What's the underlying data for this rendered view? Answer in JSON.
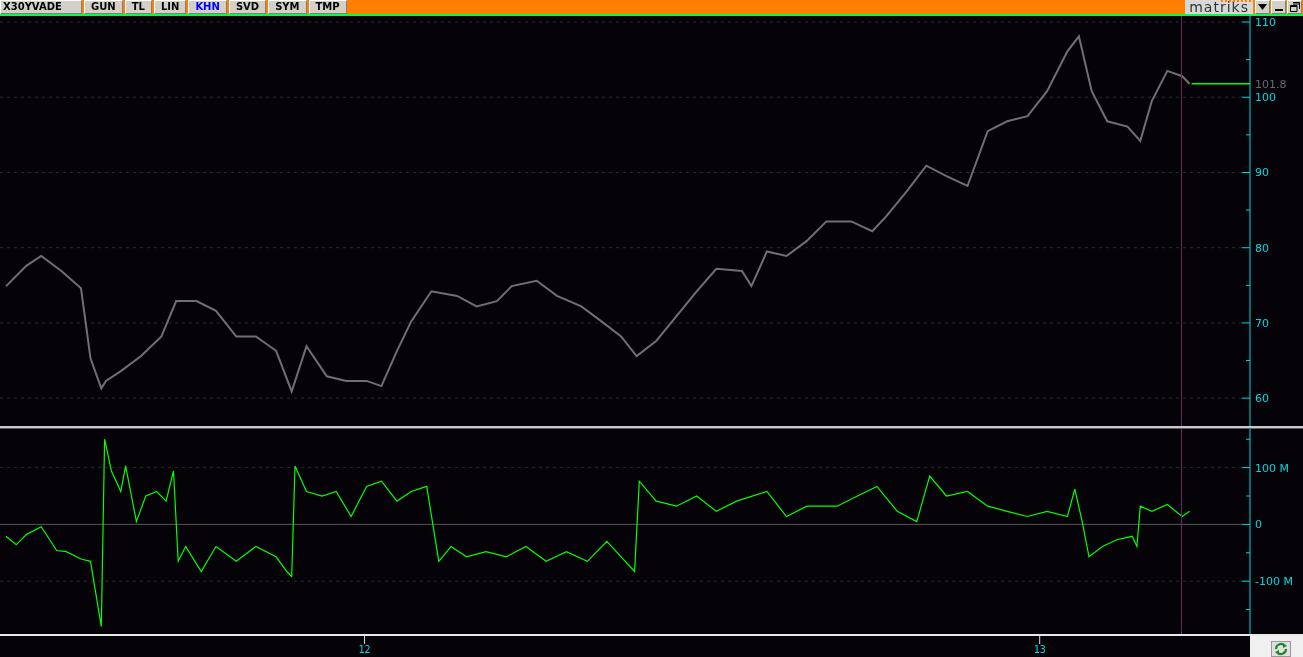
{
  "toolbar": {
    "symbol": "X30YVADE",
    "buttons": [
      {
        "label": "GUN",
        "selected": false
      },
      {
        "label": "TL",
        "selected": false
      },
      {
        "label": "LIN",
        "selected": false
      },
      {
        "label": "KHN",
        "selected": true
      },
      {
        "label": "SVD",
        "selected": false
      },
      {
        "label": "SYM",
        "selected": false
      },
      {
        "label": "TMP",
        "selected": false
      }
    ],
    "logo": "matriks"
  },
  "price_panel": {
    "chart_data": {
      "type": "line",
      "grid": true,
      "ref_lines": [
        {
          "axis": "x",
          "value": 13.21
        }
      ],
      "xlim": [
        11.46,
        13.39
      ],
      "ylim": [
        56.3,
        110.8
      ],
      "yticks": [
        60,
        70,
        80,
        90,
        100,
        110
      ],
      "x": [
        11.469,
        11.499,
        11.521,
        11.551,
        11.58,
        11.594,
        11.61,
        11.617,
        11.639,
        11.669,
        11.699,
        11.721,
        11.751,
        11.78,
        11.81,
        11.839,
        11.869,
        11.892,
        11.914,
        11.944,
        11.973,
        12.003,
        12.025,
        12.048,
        12.069,
        12.099,
        12.137,
        12.166,
        12.196,
        12.218,
        12.255,
        12.285,
        12.321,
        12.351,
        12.38,
        12.403,
        12.432,
        12.462,
        12.492,
        12.521,
        12.559,
        12.573,
        12.596,
        12.625,
        12.655,
        12.684,
        12.721,
        12.752,
        12.773,
        12.803,
        12.832,
        12.862,
        12.893,
        12.923,
        12.952,
        12.982,
        13.011,
        13.041,
        13.058,
        13.077,
        13.1,
        13.13,
        13.149,
        13.166,
        13.189,
        13.211,
        13.222
      ],
      "series": [
        {
          "color": "#707070",
          "values": [
            74.9,
            77.6,
            78.9,
            76.9,
            74.6,
            65.3,
            61.3,
            62.3,
            63.6,
            65.6,
            68.2,
            72.9,
            72.9,
            71.6,
            68.2,
            68.2,
            66.3,
            60.9,
            66.9,
            62.9,
            62.3,
            62.3,
            61.6,
            66.3,
            70.2,
            74.2,
            73.6,
            72.2,
            72.9,
            74.9,
            75.6,
            73.6,
            72.2,
            70.2,
            68.2,
            65.6,
            67.6,
            70.9,
            74.2,
            77.2,
            76.9,
            74.9,
            79.5,
            78.9,
            80.9,
            83.5,
            83.5,
            82.2,
            84.2,
            87.5,
            90.9,
            89.5,
            88.2,
            95.5,
            96.8,
            97.5,
            100.8,
            106.1,
            108.1,
            100.8,
            96.8,
            96.1,
            94.2,
            99.5,
            103.5,
            102.8,
            101.8
          ]
        }
      ],
      "annotations": [
        "101.8"
      ]
    }
  },
  "indicator_panel": {
    "chart_data": {
      "type": "line",
      "grid": true,
      "ref_lines": [
        {
          "axis": "x",
          "value": 13.21
        }
      ],
      "xlim": [
        11.46,
        13.39
      ],
      "ylim": [
        -193,
        168
      ],
      "yticks": [
        {
          "value": 100,
          "label": "100 M"
        },
        {
          "value": 0,
          "label": "0"
        },
        {
          "value": -100,
          "label": "-100 M"
        }
      ],
      "xticks": [
        12,
        13
      ],
      "x": [
        11.469,
        11.484,
        11.499,
        11.521,
        11.544,
        11.558,
        11.58,
        11.594,
        11.61,
        11.615,
        11.625,
        11.639,
        11.646,
        11.662,
        11.676,
        11.692,
        11.706,
        11.717,
        11.724,
        11.735,
        11.758,
        11.78,
        11.81,
        11.839,
        11.869,
        11.885,
        11.892,
        11.897,
        11.914,
        11.937,
        11.958,
        11.98,
        12.003,
        12.025,
        12.048,
        12.069,
        12.092,
        12.11,
        12.128,
        12.151,
        12.18,
        12.21,
        12.239,
        12.269,
        12.299,
        12.33,
        12.359,
        12.38,
        12.4,
        12.407,
        12.432,
        12.462,
        12.492,
        12.521,
        12.551,
        12.596,
        12.625,
        12.655,
        12.7,
        12.73,
        12.759,
        12.789,
        12.818,
        12.837,
        12.862,
        12.893,
        12.923,
        12.952,
        12.982,
        13.011,
        13.041,
        13.052,
        13.063,
        13.073,
        13.093,
        13.114,
        13.137,
        13.144,
        13.149,
        13.166,
        13.189,
        13.211,
        13.222
      ],
      "series": [
        {
          "color": "#00ff00",
          "values": [
            -21,
            -36,
            -18,
            -4,
            -46,
            -48,
            -61,
            -65,
            -180,
            150,
            94,
            58,
            103,
            5,
            50,
            58,
            41,
            94,
            -65,
            -39,
            -83,
            -39,
            -65,
            -39,
            -57,
            -83,
            -92,
            103,
            58,
            50,
            58,
            14,
            67,
            76,
            41,
            58,
            67,
            -65,
            -39,
            -57,
            -48,
            -57,
            -39,
            -65,
            -48,
            -65,
            -30,
            -57,
            -83,
            76,
            41,
            32,
            50,
            23,
            41,
            58,
            14,
            32,
            32,
            50,
            67,
            23,
            5,
            85,
            50,
            58,
            32,
            23,
            14,
            23,
            14,
            62,
            5,
            -57,
            -39,
            -27,
            -21,
            -39,
            32,
            23,
            35,
            14,
            23
          ]
        }
      ]
    }
  }
}
